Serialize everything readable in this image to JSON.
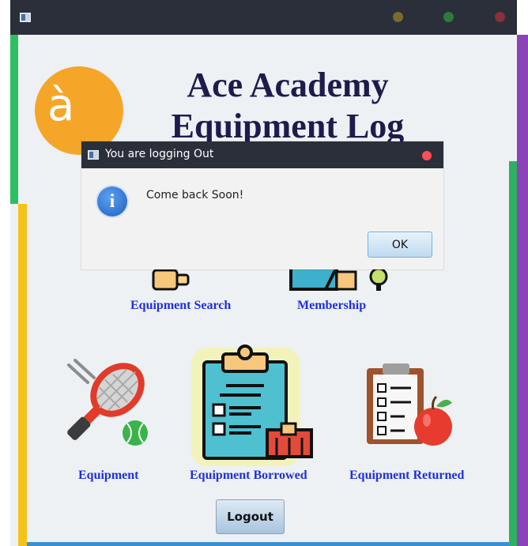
{
  "window": {
    "icons": {
      "app": "app-window-icon",
      "minimize": "minimize-dot-icon",
      "maximize": "maximize-dot-icon",
      "close": "close-dot-icon"
    }
  },
  "brand": {
    "title": "Ace Academy Equipment Log",
    "title_line1": "Ace Academy",
    "title_line2": "Equipment Log",
    "logo_icon": "ace-academy-logo",
    "logo_glyph": "à"
  },
  "menu": {
    "items": [
      {
        "label": "Equipment Search",
        "icon": "equipment-search-icon"
      },
      {
        "label": "Membership",
        "icon": "membership-icon"
      },
      {
        "label": "Equipment",
        "icon": "tennis-racket-icon"
      },
      {
        "label": "Equipment Borrowed",
        "icon": "clipboard-borrowed-icon"
      },
      {
        "label": "Equipment Returned",
        "icon": "clipboard-returned-icon"
      }
    ]
  },
  "logout": {
    "label": "Logout"
  },
  "dialog": {
    "title": "You are logging Out",
    "message": "Come back Soon!",
    "ok_label": "OK",
    "info_icon": "info-icon",
    "info_glyph": "i"
  },
  "colors": {
    "titlebar": "#2b2f3a",
    "content_bg": "#edf1f4",
    "label_blue": "#1f2fe0",
    "title_navy": "#1f1b4d",
    "accent_green": "#2dbf63",
    "accent_yellow": "#f5c21a",
    "accent_purple": "#8b44b8",
    "accent_blue": "#3a8fd0",
    "logo_orange": "#f5a629"
  }
}
